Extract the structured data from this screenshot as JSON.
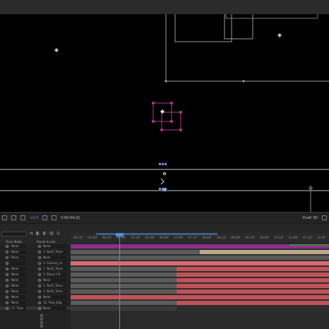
{
  "viewer_toolbar": {
    "zoom": "+0.0",
    "timecode": "0:00:04:21",
    "renderer": "Draft 3D"
  },
  "timeline": {
    "ruler_ticks": [
      "00:12f",
      "04:00f",
      "08:12f",
      "04:00f",
      "12:12f",
      "05:00f",
      "06:00f",
      "07:00f",
      "07:12f",
      "08:00f",
      "08:12f",
      "09:00f",
      "09:12f",
      "10:00f",
      "10:12f",
      "11:00f",
      "11:12f",
      "12:00"
    ],
    "columns": {
      "track_matte": "Track Matte",
      "parent_link": "Parent & Link"
    },
    "layers": [
      {
        "track_matte": "None",
        "parent": "None"
      },
      {
        "track_matte": "None",
        "parent": "1. Null1_Trans"
      },
      {
        "track_matte": "None",
        "parent": "None"
      },
      {
        "track_matte": "",
        "parent": "3. Camera_ch"
      },
      {
        "track_matte": "None",
        "parent": "1. Null1_Trans"
      },
      {
        "track_matte": "None",
        "parent": "5. Plane 2 N"
      },
      {
        "track_matte": "None",
        "parent": "None"
      },
      {
        "track_matte": "None",
        "parent": "1. Null1_Trans"
      },
      {
        "track_matte": "None",
        "parent": "1. Null1_Trans"
      },
      {
        "track_matte": "None",
        "parent": "None"
      },
      {
        "track_matte": "None",
        "parent": "10. Flow_Edg"
      },
      {
        "track_matte": "17. Flow",
        "parent": "None"
      }
    ]
  },
  "colors": {
    "purple": "#8c2f8c",
    "red": "#c0535a",
    "pink": "#d86a74",
    "tan": "#b9a98a",
    "grey": "#5b5b5b",
    "green": "#3e8c3e",
    "playhead": "#4c8ee0",
    "magenta_shape": "#b03a8c"
  }
}
